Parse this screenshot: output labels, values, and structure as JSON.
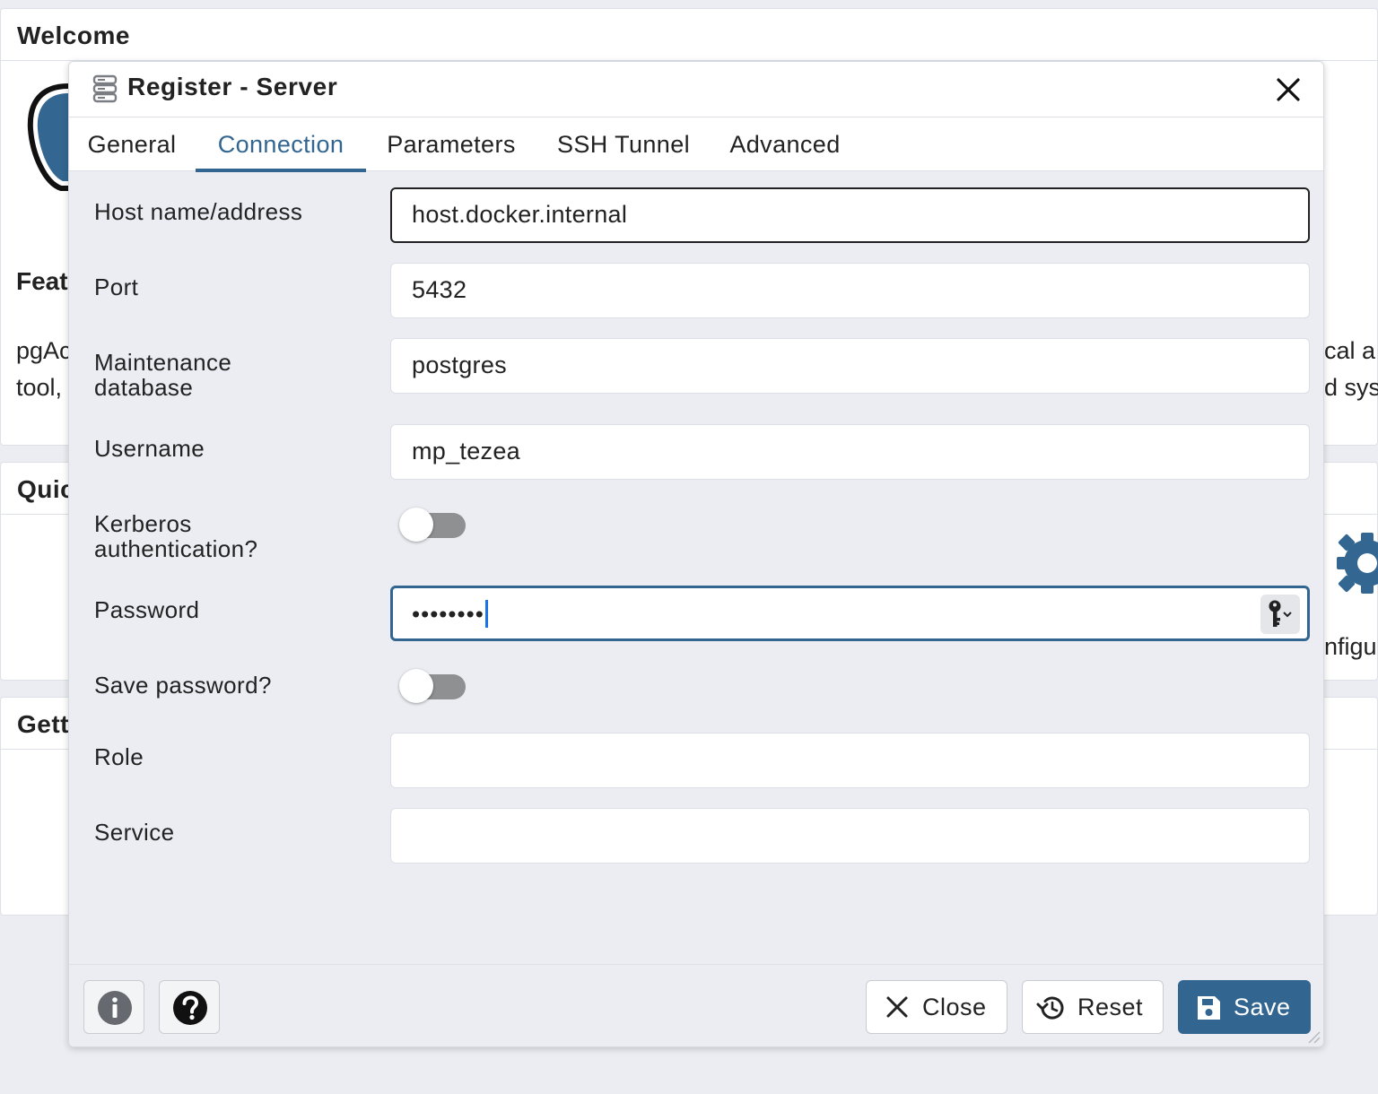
{
  "background": {
    "welcome_title": "Welcome",
    "features_title_partial": "Feat",
    "intro_left_line1": "pgAc",
    "intro_left_line2": "tool,",
    "intro_right_line1": "cal a",
    "intro_right_line2": "d sys",
    "quick_title_partial": "Quic",
    "configure_partial": "nfigu",
    "getting_title_partial": "Gett"
  },
  "dialog": {
    "title": "Register - Server",
    "icon": "server-icon",
    "tabs": [
      {
        "label": "General",
        "active": false
      },
      {
        "label": "Connection",
        "active": true
      },
      {
        "label": "Parameters",
        "active": false
      },
      {
        "label": "SSH Tunnel",
        "active": false
      },
      {
        "label": "Advanced",
        "active": false
      }
    ],
    "fields": {
      "host": {
        "label": "Host name/address",
        "value": "host.docker.internal"
      },
      "port": {
        "label": "Port",
        "value": "5432"
      },
      "maintenance_db": {
        "label_line1": "Maintenance",
        "label_line2": "database",
        "value": "postgres"
      },
      "username": {
        "label": "Username",
        "value": "mp_tezea"
      },
      "kerberos": {
        "label_line1": "Kerberos",
        "label_line2": "authentication?",
        "enabled": false
      },
      "password": {
        "label": "Password",
        "masked_value": "••••••••"
      },
      "save_password": {
        "label": "Save password?",
        "enabled": false
      },
      "role": {
        "label": "Role",
        "value": ""
      },
      "service": {
        "label": "Service",
        "value": ""
      }
    },
    "footer": {
      "info_icon": "info-icon",
      "help_icon": "help-icon",
      "close_label": "Close",
      "reset_label": "Reset",
      "save_label": "Save"
    }
  },
  "colors": {
    "accent": "#326690",
    "background": "#ebedf2",
    "focus_caret": "#1a73e8",
    "toggle_off": "#8e9092"
  }
}
